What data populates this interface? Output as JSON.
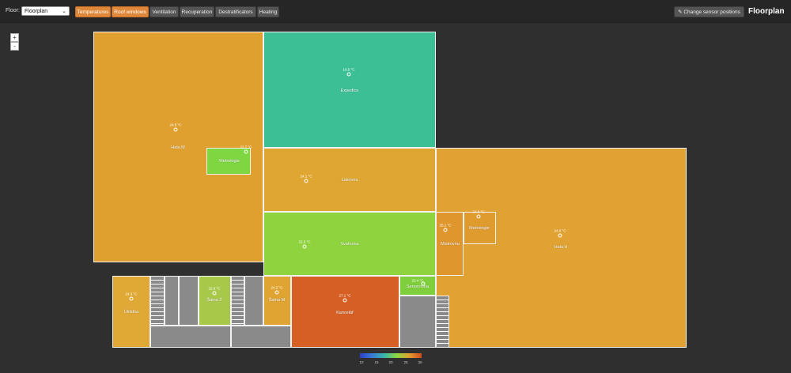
{
  "header": {
    "floor_label": "Floor:",
    "floor_value": "Floorplan",
    "tabs": [
      {
        "label": "Temperatures",
        "active": true
      },
      {
        "label": "Roof windows",
        "active": true
      },
      {
        "label": "Ventilation",
        "active": false
      },
      {
        "label": "Recuperation",
        "active": false
      },
      {
        "label": "Destratificators",
        "active": false
      },
      {
        "label": "Heating",
        "active": false
      }
    ],
    "sensor_button": "Change sensor positions",
    "title": "Floorplan"
  },
  "zoom": {
    "in": "+",
    "out": "-"
  },
  "rooms": {
    "hala_m": {
      "name": "Hala M",
      "temp": "24.5 °C",
      "color": "#e0a030"
    },
    "metrologie_1": {
      "name": "Metrologie",
      "temp": "22.7 °C",
      "color": "#7ed640"
    },
    "expedice": {
      "name": "Expedice",
      "temp": "19.5 °C",
      "color": "#3dbf96"
    },
    "lakovna": {
      "name": "Lakovna",
      "temp": "24.1 °C",
      "color": "#e0a632"
    },
    "svarovna": {
      "name": "Svařovna",
      "temp": "22.5 °C",
      "color": "#8fd33e"
    },
    "mistrovna": {
      "name": "Mistrovna",
      "temp": "25.1 °C",
      "color": "#df962c"
    },
    "metrologie_2": {
      "name": "Metrologie",
      "temp": "24.8 °C",
      "color": "#df9b2e"
    },
    "hala_h": {
      "name": "Hala H",
      "temp": "24.6 °C",
      "color": "#e0a232"
    },
    "uklidna": {
      "name": "Úklidna",
      "temp": "24.3 °C",
      "color": "#e0a834"
    },
    "satna_z": {
      "name": "Šatna Ž",
      "temp": "22.8 °C",
      "color": "#a8c84a"
    },
    "satna_m": {
      "name": "Šatna M",
      "temp": "24.2 °C",
      "color": "#e0a432"
    },
    "kancelar": {
      "name": "Kancelář",
      "temp": "27.1 °C",
      "color": "#d66024"
    },
    "serverovna": {
      "name": "Serverovna",
      "temp": "22.4 °C",
      "color": "#7fcf3c"
    }
  },
  "legend": {
    "ticks": [
      "10",
      "15",
      "20",
      "25",
      "30"
    ]
  }
}
